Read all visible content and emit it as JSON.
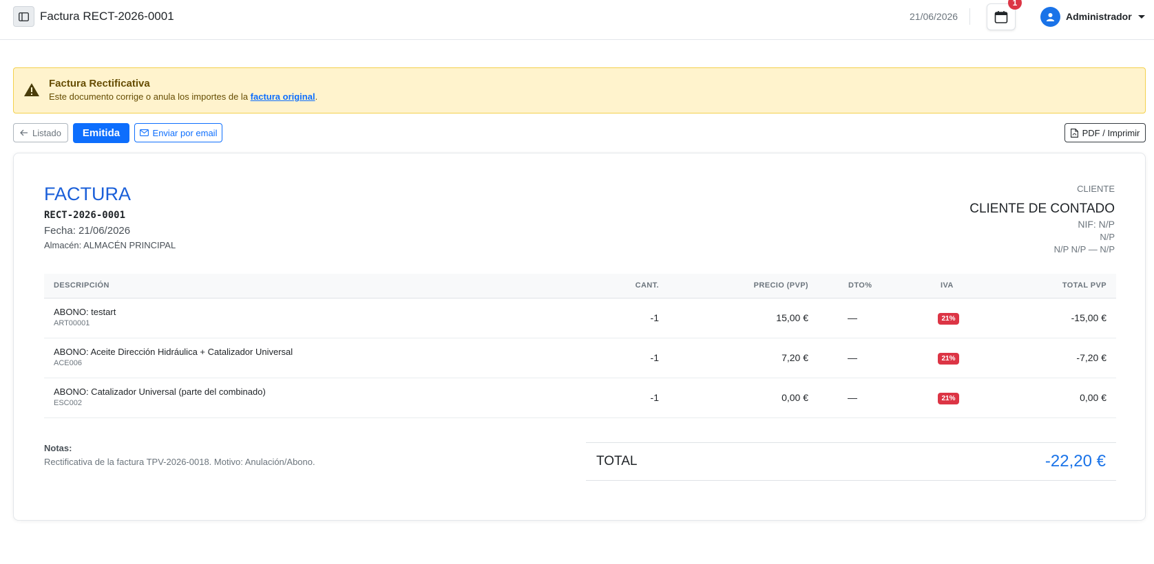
{
  "header": {
    "title": "Factura RECT-2026-0001",
    "date": "21/06/2026",
    "notification_count": "1",
    "user_name": "Administrador"
  },
  "alert": {
    "title": "Factura Rectificativa",
    "text_before": "Este documento corrige o anula los importes de la ",
    "link_text": "factura original",
    "text_after": "."
  },
  "actions": {
    "list_label": "Listado",
    "status_label": "Emitida",
    "email_label": "Enviar por email",
    "pdf_label": "PDF / Imprimir"
  },
  "invoice": {
    "type": "FACTURA",
    "number": "RECT-2026-0001",
    "date": "Fecha: 21/06/2026",
    "store": "Almacén: ALMACÉN PRINCIPAL"
  },
  "client": {
    "label": "CLIENTE",
    "name": "CLIENTE DE CONTADO",
    "nif": "NIF: N/P",
    "address": "N/P",
    "city": "N/P N/P — N/P"
  },
  "table": {
    "headers": {
      "desc": "DESCRIPCIÓN",
      "qty": "CANT.",
      "price": "PRECIO (PVP)",
      "dto": "DTO%",
      "iva": "IVA",
      "total": "TOTAL PVP"
    },
    "rows": [
      {
        "name": "ABONO: testart",
        "code": "ART00001",
        "qty": "-1",
        "price": "15,00 €",
        "dto": "—",
        "iva": "21%",
        "total": "-15,00 €"
      },
      {
        "name": "ABONO: Aceite Dirección Hidráulica + Catalizador Universal",
        "code": "ACE006",
        "qty": "-1",
        "price": "7,20 €",
        "dto": "—",
        "iva": "21%",
        "total": "-7,20 €"
      },
      {
        "name": "ABONO: Catalizador Universal (parte del combinado)",
        "code": "ESC002",
        "qty": "-1",
        "price": "0,00 €",
        "dto": "—",
        "iva": "21%",
        "total": "0,00 €"
      }
    ]
  },
  "notes": {
    "label": "Notas:",
    "text": "Rectificativa de la factura TPV-2026-0018. Motivo: Anulación/Abono."
  },
  "totals": {
    "label": "TOTAL",
    "value": "-22,20 €"
  },
  "colors": {
    "primary": "#0d6efd",
    "danger": "#dc3545",
    "warning_bg": "#fff3cd"
  }
}
